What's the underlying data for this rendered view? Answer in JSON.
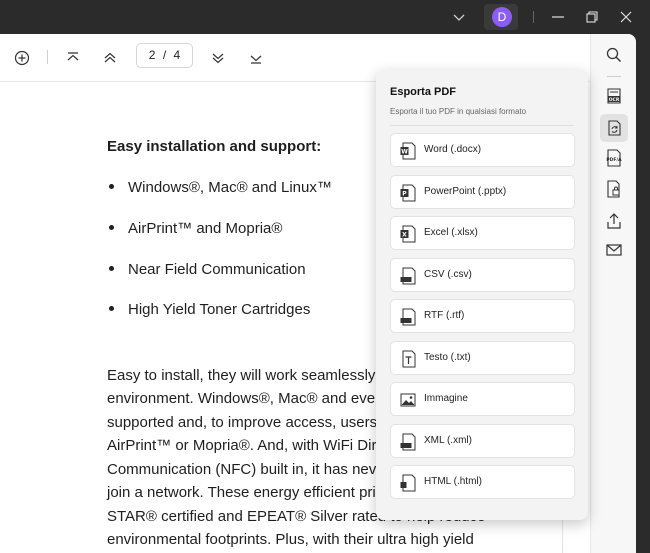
{
  "titlebar": {
    "avatar_initial": "D",
    "avatar_color": "#8b5cf6"
  },
  "toolbar": {
    "page_current": "2",
    "page_separator": "/",
    "page_total": "4"
  },
  "document": {
    "heading": "Easy installation and support:",
    "bullets": [
      "Windows®, Mac® and Linux™",
      "AirPrint™ and Mopria®",
      "Near Field Communication",
      "High Yield Toner Cartridges"
    ],
    "paragraph_lines": [
      "Easy to install, they will work seamlessly",
      "environment. Windows®, Mac® and even",
      "supported and, to improve access, users c",
      "AirPrint™ or Mopria®. And, with WiFi Dire",
      "Communication (NFC) built in, it has nev",
      "join a network. These energy efficient printers are ENERGY",
      "STAR® certified and EPEAT® Silver rated to help reduce",
      "environmental footprints. Plus, with their ultra high yield"
    ]
  },
  "export_panel": {
    "title": "Esporta PDF",
    "subtitle": "Esporta il tuo PDF in qualsiasi formato",
    "options": [
      {
        "label": "Word (.docx)",
        "icon": "word-icon"
      },
      {
        "label": "PowerPoint (.pptx)",
        "icon": "powerpoint-icon"
      },
      {
        "label": "Excel (.xlsx)",
        "icon": "excel-icon"
      },
      {
        "label": "CSV (.csv)",
        "icon": "csv-icon"
      },
      {
        "label": "RTF (.rtf)",
        "icon": "rtf-icon"
      },
      {
        "label": "Testo (.txt)",
        "icon": "text-icon"
      },
      {
        "label": "Immagine",
        "icon": "image-icon"
      },
      {
        "label": "XML (.xml)",
        "icon": "xml-icon"
      },
      {
        "label": "HTML (.html)",
        "icon": "html-icon"
      }
    ]
  },
  "rightbar": {
    "ocr_label": "OCR",
    "pdfa_label": "PDF/A"
  }
}
